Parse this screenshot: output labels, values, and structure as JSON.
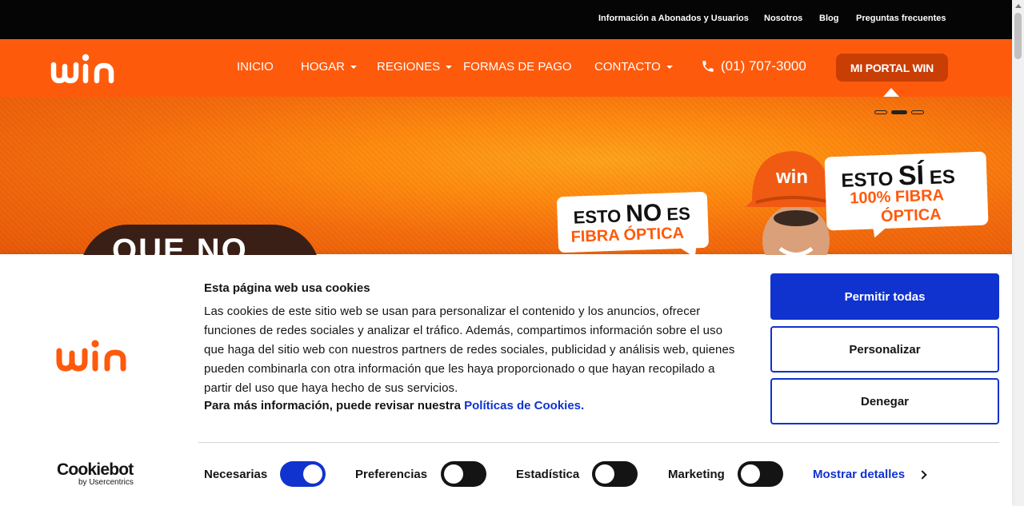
{
  "topbar": {
    "links": [
      "Información a Abonados y Usuarios",
      "Nosotros",
      "Blog",
      "Preguntas frecuentes"
    ]
  },
  "nav": {
    "logo_text": "win",
    "items": [
      {
        "label": "INICIO",
        "dropdown": false
      },
      {
        "label": "HOGAR",
        "dropdown": true
      },
      {
        "label": "REGIONES",
        "dropdown": true
      },
      {
        "label": "FORMAS DE PAGO",
        "dropdown": false
      },
      {
        "label": "CONTACTO",
        "dropdown": true
      }
    ],
    "phone": "(01) 707-3000",
    "portal_label": "MI PORTAL WIN"
  },
  "hero": {
    "bubble1_line1a": "ESTO ",
    "bubble1_line1b": "NO",
    "bubble1_line1c": " ES",
    "bubble1_line2": "FIBRA ÓPTICA",
    "bubble2_line1a": "ESTO ",
    "bubble2_line1b": "SÍ",
    "bubble2_line1c": " ES",
    "bubble2_line2": "100% FIBRA",
    "bubble2_line3": "ÓPTICA",
    "helmet_text": "win",
    "dark_text": "QUE NO",
    "slide_active": 1,
    "slide_count": 3
  },
  "cookie": {
    "logo_text": "win",
    "title": "Esta página web usa cookies",
    "body": "Las cookies de este sitio web se usan para personalizar el contenido y los anuncios, ofrecer funciones de redes sociales y analizar el tráfico. Además, compartimos información sobre el uso que haga del sitio web con nuestros partners de redes sociales, publicidad y análisis web, quienes pueden combinarla con otra información que les haya proporcionado o que hayan recopilado a partir del uso que haya hecho de sus servicios.",
    "more_text": "Para más información, puede revisar nuestra ",
    "more_link": "Políticas de Cookies.",
    "btn_allow": "Permitir todas",
    "btn_customize": "Personalizar",
    "btn_deny": "Denegar",
    "cookiebot_name": "Cookiebot",
    "cookiebot_sub": "by Usercentrics",
    "toggles": [
      {
        "label": "Necesarias",
        "on": true
      },
      {
        "label": "Preferencias",
        "on": false
      },
      {
        "label": "Estadística",
        "on": false
      },
      {
        "label": "Marketing",
        "on": false
      }
    ],
    "details_label": "Mostrar detalles"
  },
  "colors": {
    "brand_orange": "#fe5a0c",
    "cookie_blue": "#1032cf"
  }
}
